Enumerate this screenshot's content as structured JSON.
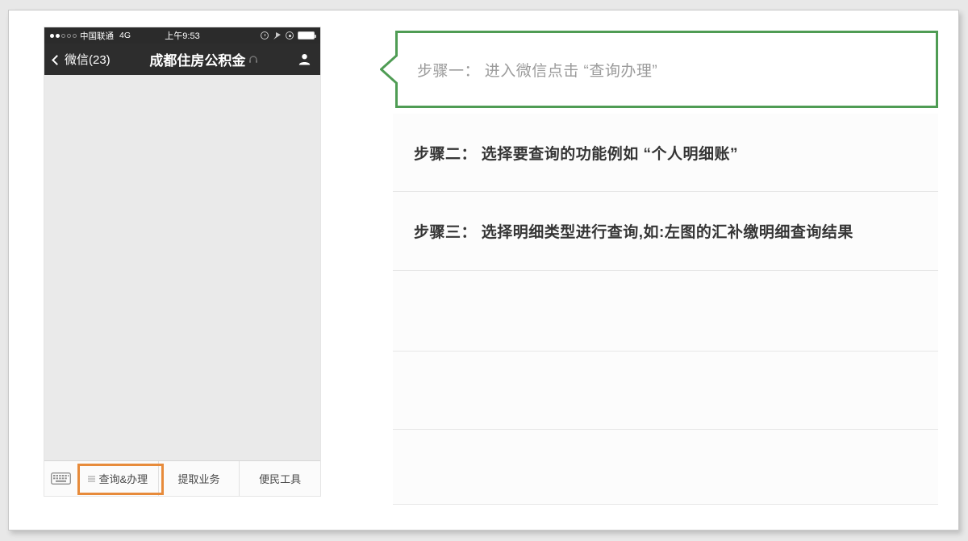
{
  "phone": {
    "status_bar": {
      "carrier": "中国联通",
      "network": "4G",
      "time": "上午9:53"
    },
    "nav_bar": {
      "back_label": "微信(23)",
      "title": "成都住房公积金"
    },
    "menu_bar": {
      "items": [
        {
          "label": "查询&办理",
          "highlighted": true
        },
        {
          "label": "提取业务",
          "highlighted": false
        },
        {
          "label": "便民工具",
          "highlighted": false
        }
      ]
    }
  },
  "steps": [
    {
      "label": "步骤一： 进入微信点击 “查询办理”"
    },
    {
      "label": "步骤二： 选择要查询的功能例如 “个人明细账”"
    },
    {
      "label": "步骤三： 选择明细类型进行查询,如:左图的汇补缴明细查询结果"
    }
  ],
  "colors": {
    "accent_green": "#4f9c54",
    "highlight_orange": "#e78b3b",
    "bar_dark": "#2b2b2b"
  }
}
